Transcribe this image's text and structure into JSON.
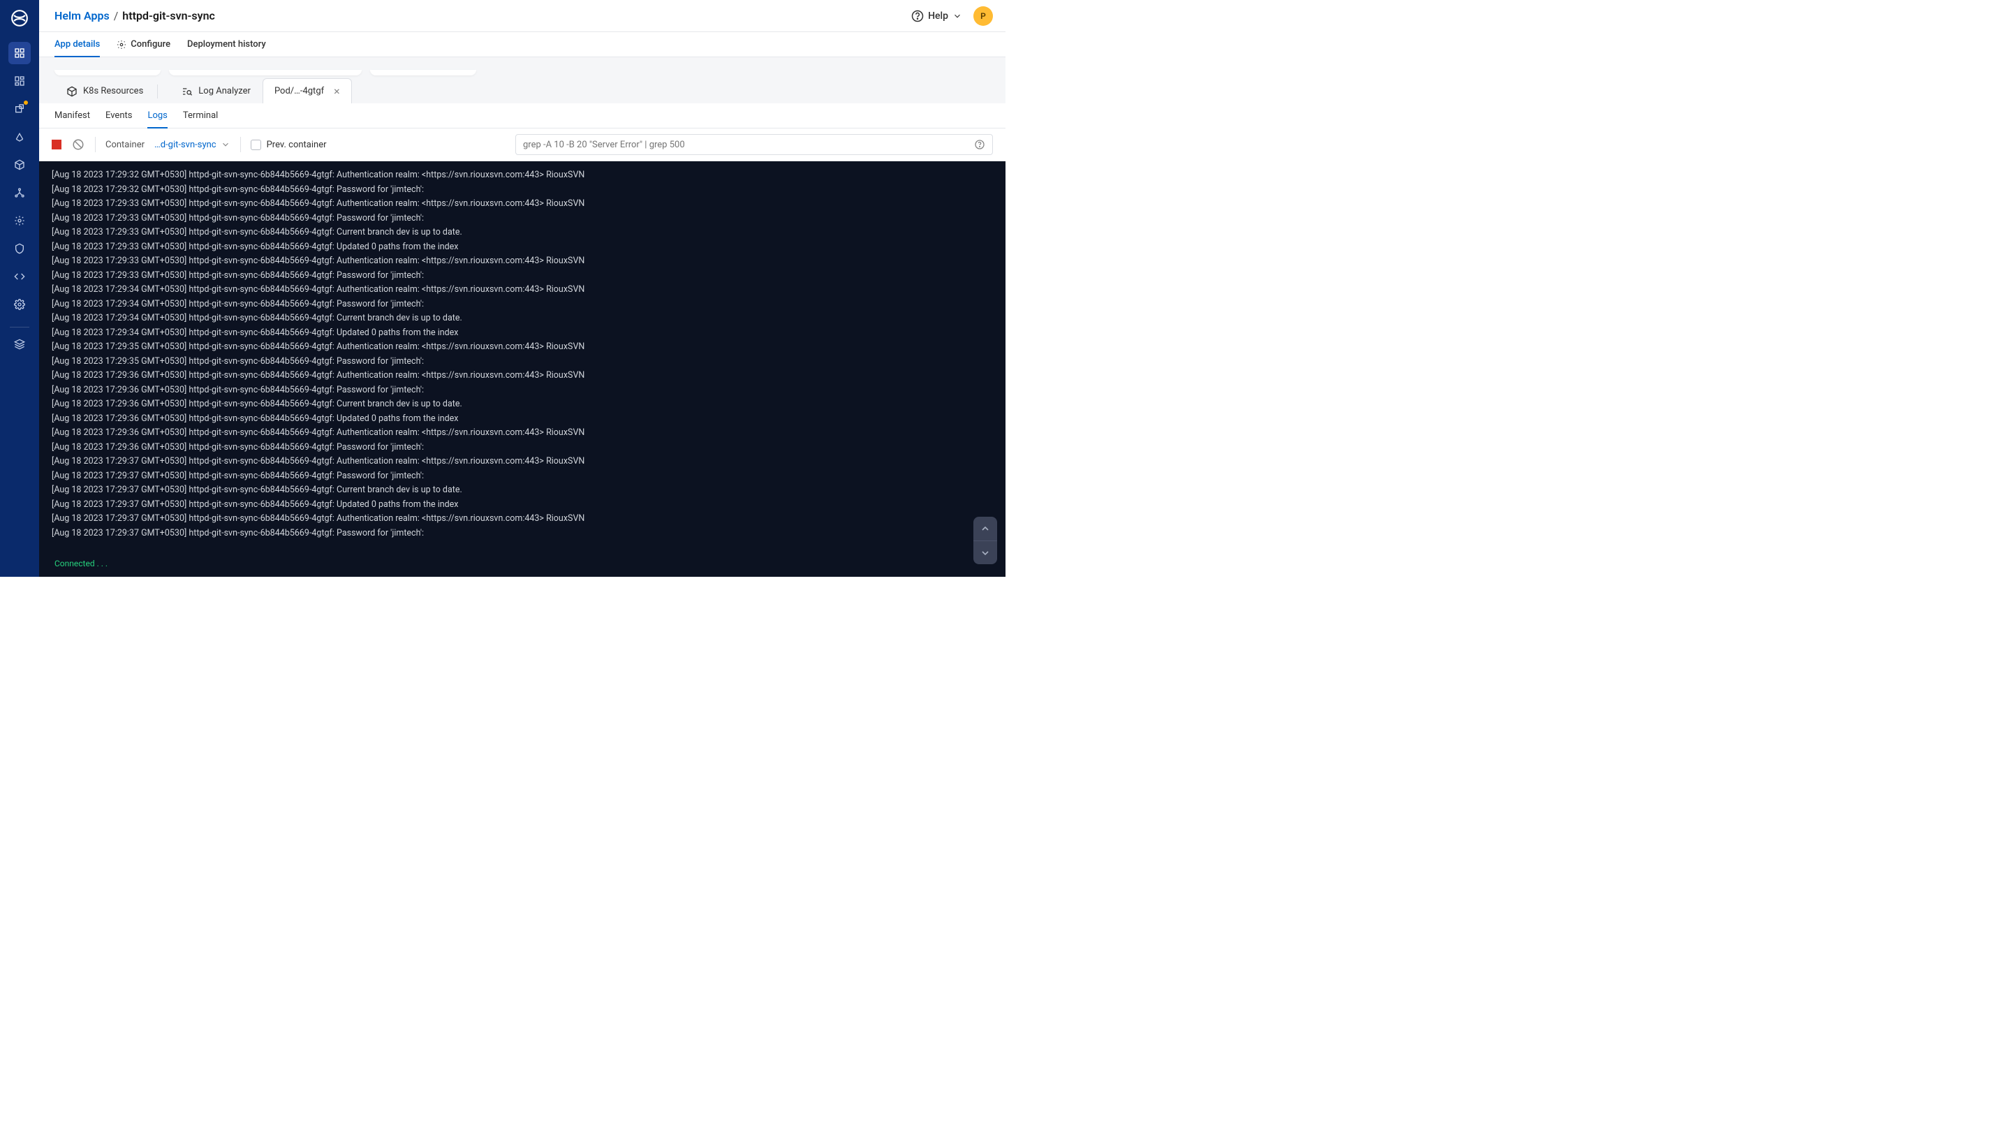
{
  "breadcrumb": {
    "root": "Helm Apps",
    "sep": "/",
    "current": "httpd-git-svn-sync"
  },
  "help_label": "Help",
  "avatar_initial": "P",
  "page_tabs": [
    "App details",
    "Configure",
    "Deployment history"
  ],
  "resource_tabs": {
    "k8s": "K8s Resources",
    "log_analyzer": "Log Analyzer",
    "pod": "Pod/…-4gtgf"
  },
  "sub_tabs": [
    "Manifest",
    "Events",
    "Logs",
    "Terminal"
  ],
  "toolbar": {
    "container_label": "Container",
    "container_value": "…d-git-svn-sync",
    "prev_container": "Prev. container",
    "search_placeholder": "grep -A 10 -B 20 \"Server Error\" | grep 500"
  },
  "connected": "Connected . . .",
  "log_lines": [
    "[Aug 18 2023 17:29:32 GMT+0530] httpd-git-svn-sync-6b844b5669-4gtgf: Authentication realm: <https://svn.riouxsvn.com:443> RiouxSVN",
    "[Aug 18 2023 17:29:32 GMT+0530] httpd-git-svn-sync-6b844b5669-4gtgf: Password for 'jimtech':",
    "[Aug 18 2023 17:29:33 GMT+0530] httpd-git-svn-sync-6b844b5669-4gtgf: Authentication realm: <https://svn.riouxsvn.com:443> RiouxSVN",
    "[Aug 18 2023 17:29:33 GMT+0530] httpd-git-svn-sync-6b844b5669-4gtgf: Password for 'jimtech':",
    "[Aug 18 2023 17:29:33 GMT+0530] httpd-git-svn-sync-6b844b5669-4gtgf: Current branch dev is up to date.",
    "[Aug 18 2023 17:29:33 GMT+0530] httpd-git-svn-sync-6b844b5669-4gtgf: Updated 0 paths from the index",
    "[Aug 18 2023 17:29:33 GMT+0530] httpd-git-svn-sync-6b844b5669-4gtgf: Authentication realm: <https://svn.riouxsvn.com:443> RiouxSVN",
    "[Aug 18 2023 17:29:33 GMT+0530] httpd-git-svn-sync-6b844b5669-4gtgf: Password for 'jimtech':",
    "[Aug 18 2023 17:29:34 GMT+0530] httpd-git-svn-sync-6b844b5669-4gtgf: Authentication realm: <https://svn.riouxsvn.com:443> RiouxSVN",
    "[Aug 18 2023 17:29:34 GMT+0530] httpd-git-svn-sync-6b844b5669-4gtgf: Password for 'jimtech':",
    "[Aug 18 2023 17:29:34 GMT+0530] httpd-git-svn-sync-6b844b5669-4gtgf: Current branch dev is up to date.",
    "[Aug 18 2023 17:29:34 GMT+0530] httpd-git-svn-sync-6b844b5669-4gtgf: Updated 0 paths from the index",
    "[Aug 18 2023 17:29:35 GMT+0530] httpd-git-svn-sync-6b844b5669-4gtgf: Authentication realm: <https://svn.riouxsvn.com:443> RiouxSVN",
    "[Aug 18 2023 17:29:35 GMT+0530] httpd-git-svn-sync-6b844b5669-4gtgf: Password for 'jimtech':",
    "[Aug 18 2023 17:29:36 GMT+0530] httpd-git-svn-sync-6b844b5669-4gtgf: Authentication realm: <https://svn.riouxsvn.com:443> RiouxSVN",
    "[Aug 18 2023 17:29:36 GMT+0530] httpd-git-svn-sync-6b844b5669-4gtgf: Password for 'jimtech':",
    "[Aug 18 2023 17:29:36 GMT+0530] httpd-git-svn-sync-6b844b5669-4gtgf: Current branch dev is up to date.",
    "[Aug 18 2023 17:29:36 GMT+0530] httpd-git-svn-sync-6b844b5669-4gtgf: Updated 0 paths from the index",
    "[Aug 18 2023 17:29:36 GMT+0530] httpd-git-svn-sync-6b844b5669-4gtgf: Authentication realm: <https://svn.riouxsvn.com:443> RiouxSVN",
    "[Aug 18 2023 17:29:36 GMT+0530] httpd-git-svn-sync-6b844b5669-4gtgf: Password for 'jimtech':",
    "[Aug 18 2023 17:29:37 GMT+0530] httpd-git-svn-sync-6b844b5669-4gtgf: Authentication realm: <https://svn.riouxsvn.com:443> RiouxSVN",
    "[Aug 18 2023 17:29:37 GMT+0530] httpd-git-svn-sync-6b844b5669-4gtgf: Password for 'jimtech':",
    "[Aug 18 2023 17:29:37 GMT+0530] httpd-git-svn-sync-6b844b5669-4gtgf: Current branch dev is up to date.",
    "[Aug 18 2023 17:29:37 GMT+0530] httpd-git-svn-sync-6b844b5669-4gtgf: Updated 0 paths from the index",
    "[Aug 18 2023 17:29:37 GMT+0530] httpd-git-svn-sync-6b844b5669-4gtgf: Authentication realm: <https://svn.riouxsvn.com:443> RiouxSVN",
    "[Aug 18 2023 17:29:37 GMT+0530] httpd-git-svn-sync-6b844b5669-4gtgf: Password for 'jimtech':"
  ]
}
